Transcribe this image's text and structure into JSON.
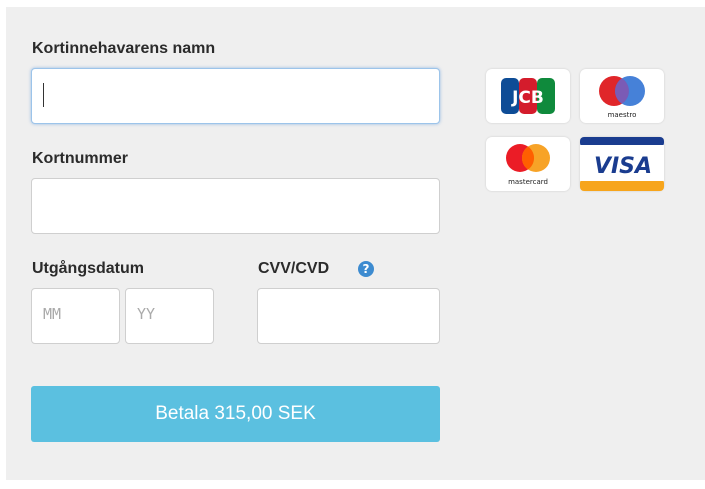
{
  "form": {
    "name_label": "Kortinnehavarens namn",
    "name_value": "",
    "number_label": "Kortnummer",
    "number_value": "",
    "expiry_label": "Utgångsdatum",
    "month_placeholder": "MM",
    "year_placeholder": "YY",
    "cvv_label": "CVV/CVD",
    "help_glyph": "?",
    "pay_button": "Betala 315,00 SEK"
  },
  "cards": [
    {
      "icon": "jcb-logo",
      "text": "JCB"
    },
    {
      "icon": "maestro-logo",
      "text": "maestro"
    },
    {
      "icon": "mastercard-logo",
      "text": "mastercard"
    },
    {
      "icon": "visa-logo",
      "text": "VISA"
    }
  ],
  "colors": {
    "accent": "#5bc0e0",
    "help_icon": "#3d8bd0",
    "panel_bg": "#efefef"
  }
}
